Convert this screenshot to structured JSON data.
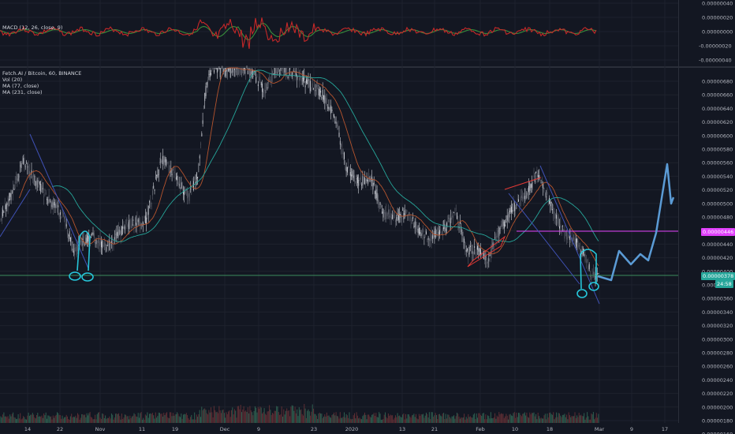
{
  "macd": {
    "label": "MACD (12, 26, close, 9)",
    "ticks": [
      {
        "v": 4e-08,
        "label": "0.00000040"
      },
      {
        "v": 2e-08,
        "label": "0.00000020"
      },
      {
        "v": 0,
        "label": "0.00000000"
      },
      {
        "v": -2e-08,
        "label": "-0.00000020"
      },
      {
        "v": -4e-08,
        "label": "-0.00000040"
      }
    ]
  },
  "main": {
    "symbol_line": "Fetch.AI / Bitcoin, 60, BINANCE",
    "indicators": [
      "Vol (20)",
      "MA (77, close)",
      "MA (231, close)"
    ],
    "ticks": [
      "0.00000680",
      "0.00000660",
      "0.00000640",
      "0.00000620",
      "0.00000600",
      "0.00000580",
      "0.00000560",
      "0.00000540",
      "0.00000520",
      "0.00000500",
      "0.00000480",
      "0.00000460",
      "0.00000440",
      "0.00000420",
      "0.00000400",
      "0.00000380",
      "0.00000360",
      "0.00000340",
      "0.00000320",
      "0.00000300",
      "0.00000280",
      "0.00000260",
      "0.00000240",
      "0.00000220",
      "0.00000200",
      "0.00000180",
      "0.00000160"
    ],
    "resistance_label": "0.00000446",
    "current_price_label": "0.00000378",
    "countdown_label": "24:58"
  },
  "time_axis": [
    "14",
    "22",
    "Nov",
    "11",
    "19",
    "Dec",
    "9",
    "23",
    "2020",
    "13",
    "21",
    "Feb",
    "10",
    "18",
    "Mar",
    "9",
    "17"
  ],
  "colors": {
    "background": "#131722",
    "grid": "#1e222d",
    "macd_line": "#c62828",
    "signal_line": "#388e3c",
    "ma_fast": "#b5542e",
    "ma_slow": "#26a69a",
    "support": "#3b8e5c",
    "resistance": "#e040fb",
    "channel": "#3f51b5",
    "drawing": "#26c6da",
    "projection": "#5b9bd5",
    "wedge": "#e53935"
  }
}
